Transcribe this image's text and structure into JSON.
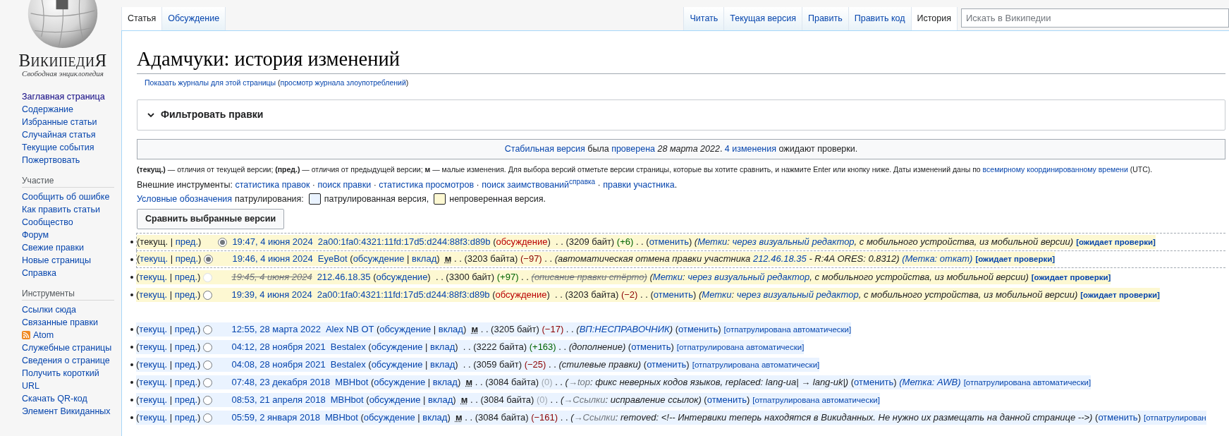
{
  "sidebar": {
    "logo": {
      "wordmark": "ВикипедиЯ",
      "tagline": "Свободная энциклопедия"
    },
    "sections": [
      {
        "items": [
          {
            "label": "Заглавная страница",
            "kind": "link",
            "visited": true
          },
          {
            "label": "Содержание",
            "kind": "link",
            "visited": false
          },
          {
            "label": "Избранные статьи",
            "kind": "link",
            "visited": false
          },
          {
            "label": "Случайная статья",
            "kind": "link",
            "visited": false
          },
          {
            "label": "Текущие события",
            "kind": "link",
            "visited": false
          },
          {
            "label": "Пожертвовать",
            "kind": "link",
            "visited": false
          }
        ]
      },
      {
        "heading": "Участие",
        "items": [
          {
            "label": "Сообщить об ошибке",
            "kind": "link",
            "visited": false
          },
          {
            "label": "Как править статьи",
            "kind": "link",
            "visited": false
          },
          {
            "label": "Сообщество",
            "kind": "link",
            "visited": false
          },
          {
            "label": "Форум",
            "kind": "link",
            "visited": false
          },
          {
            "label": "Свежие правки",
            "kind": "link",
            "visited": false
          },
          {
            "label": "Новые страницы",
            "kind": "link",
            "visited": false
          },
          {
            "label": "Справка",
            "kind": "link",
            "visited": false
          }
        ]
      },
      {
        "heading": "Инструменты",
        "items": [
          {
            "label": "Ссылки сюда",
            "kind": "link",
            "visited": false
          },
          {
            "label": "Связанные правки",
            "kind": "link",
            "visited": false
          },
          {
            "label": "Atom",
            "kind": "feed",
            "visited": false
          },
          {
            "label": "Служебные страницы",
            "kind": "link",
            "visited": false
          },
          {
            "label": "Сведения о странице",
            "kind": "link",
            "visited": false
          },
          {
            "label": "Получить короткий URL",
            "kind": "link",
            "visited": false
          },
          {
            "label": "Скачать QR-код",
            "kind": "link",
            "visited": false
          },
          {
            "label": "Элемент Викиданных",
            "kind": "link",
            "visited": false
          }
        ]
      }
    ]
  },
  "tabs_left": [
    {
      "label": "Статья",
      "selected": true
    },
    {
      "label": "Обсуждение",
      "selected": false
    }
  ],
  "tabs_right": [
    {
      "label": "Читать",
      "selected": false
    },
    {
      "label": "Текущая версия",
      "selected": false
    },
    {
      "label": "Править",
      "selected": false
    },
    {
      "label": "Править код",
      "selected": false
    },
    {
      "label": "История",
      "selected": true
    }
  ],
  "search": {
    "placeholder": "Искать в Википедии"
  },
  "title": "Адамчуки: история изменений",
  "subtitle": [
    {
      "kind": "link",
      "text": "Показать журналы для этой страницы"
    },
    {
      "kind": "text",
      "text": " ("
    },
    {
      "kind": "link",
      "text": "просмотр журнала злоупотреблений"
    },
    {
      "kind": "text",
      "text": ")"
    }
  ],
  "filter": {
    "label": "Фильтровать правки",
    "expanded": false
  },
  "stable_notice": [
    {
      "kind": "link",
      "text": "Стабильная версия"
    },
    {
      "kind": "text",
      "text": " была "
    },
    {
      "kind": "link",
      "text": "проверена"
    },
    {
      "kind": "text",
      "text": " *28 марта 2022*. "
    },
    {
      "kind": "link",
      "text": "4 изменения"
    },
    {
      "kind": "text",
      "text": " ожидают проверки."
    }
  ],
  "note": [
    {
      "kind": "text",
      "text": "**(текущ.)** — отличия от текущей версии; **(пред.)** — отличия от предыдущей версии; **м** — малые изменения. Для выбора версий отметьте версии страницы, которые вы хотите сравнить, и нажмите Enter или кнопку ниже. Даты изменений даны по "
    },
    {
      "kind": "link",
      "text": "всемирному координированному времени"
    },
    {
      "kind": "text",
      "text": " (UTC)."
    }
  ],
  "external_tools": [
    {
      "kind": "text",
      "text": "Внешние инструменты: "
    },
    {
      "kind": "link",
      "text": "статистика правок"
    },
    {
      "kind": "text",
      "text": " · "
    },
    {
      "kind": "link",
      "text": "поиск правки"
    },
    {
      "kind": "text",
      "text": " · "
    },
    {
      "kind": "link",
      "text": "статистика просмотров"
    },
    {
      "kind": "text",
      "text": " · "
    },
    {
      "kind": "link",
      "text": "поиск заимствований"
    },
    {
      "kind": "sup",
      "text": "справка"
    },
    {
      "kind": "text",
      "text": " · "
    },
    {
      "kind": "link",
      "text": "правки участника"
    },
    {
      "kind": "text",
      "text": "."
    }
  ],
  "legend": {
    "link": "Условные обозначения",
    "label": "патрулирования:",
    "items": [
      {
        "label": "патрулированная версия,",
        "color": "#eaf3ff"
      },
      {
        "label": "непроверенная версия.",
        "color": "#fdf8d2"
      }
    ]
  },
  "compare_button": "Сравнить выбранные версии",
  "rows": [
    {
      "pending": true,
      "in_range": true,
      "gap_before": false,
      "radio": {
        "kind": "right",
        "selected": true,
        "disabled": false
      },
      "diff": [
        {
          "kind": "text",
          "text": "(текущ."
        },
        {
          "kind": "text",
          "text": " | "
        },
        {
          "kind": "link",
          "text": "пред."
        },
        {
          "kind": "text",
          "text": ")"
        }
      ],
      "parts": [
        {
          "kind": "date",
          "text": "19:47, 4 июня 2024"
        },
        {
          "kind": "user",
          "text": "2a00:1fa0:4321:11fd:17d5:d244:88f3:d89b"
        },
        {
          "kind": "text",
          "text": " ("
        },
        {
          "kind": "new",
          "text": "обсуждение"
        },
        {
          "kind": "text",
          "text": ")  . . (3209 байт) "
        },
        {
          "kind": "pos",
          "text": "(+6)"
        },
        {
          "kind": "text",
          "text": " . . ("
        },
        {
          "kind": "link",
          "text": "отменить"
        },
        {
          "kind": "text",
          "text": ") "
        },
        {
          "kind": "tag",
          "text": "("
        },
        {
          "kind": "tag_link",
          "text": "Метки"
        },
        {
          "kind": "tag",
          "text": ": "
        },
        {
          "kind": "tag_link",
          "text": "через визуальный редактор"
        },
        {
          "kind": "tag",
          "text": ", с мобильного устройства, из мобильной версии)"
        },
        {
          "kind": "pending",
          "text": "[ожидает проверки]"
        }
      ]
    },
    {
      "pending": true,
      "in_range": true,
      "gap_before": false,
      "radio": {
        "kind": "left",
        "selected": true,
        "disabled": false
      },
      "diff": [
        {
          "kind": "text",
          "text": "("
        },
        {
          "kind": "link",
          "text": "текущ."
        },
        {
          "kind": "text",
          "text": " | "
        },
        {
          "kind": "link",
          "text": "пред."
        },
        {
          "kind": "text",
          "text": ")"
        }
      ],
      "parts": [
        {
          "kind": "date",
          "text": "19:46, 4 июня 2024"
        },
        {
          "kind": "user",
          "text": "EyeBot"
        },
        {
          "kind": "text",
          "text": " ("
        },
        {
          "kind": "link",
          "text": "обсуждение"
        },
        {
          "kind": "text",
          "text": " | "
        },
        {
          "kind": "link",
          "text": "вклад"
        },
        {
          "kind": "text",
          "text": ")  "
        },
        {
          "kind": "minor",
          "text": "м"
        },
        {
          "kind": "text",
          "text": " . . (3203 байта) "
        },
        {
          "kind": "neg",
          "text": "(−97)"
        },
        {
          "kind": "text",
          "text": " . . "
        },
        {
          "kind": "comment",
          "text": "(автоматическая отмена правки участника "
        },
        {
          "kind": "comment_link",
          "text": "212.46.18.35"
        },
        {
          "kind": "comment",
          "text": " - R:4A ORES: 0.8312) "
        },
        {
          "kind": "tag_link",
          "text": "(Метка: откат)"
        },
        {
          "kind": "pending",
          "text": "[ожидает проверки]"
        }
      ]
    },
    {
      "pending": true,
      "in_range": false,
      "gap_before": false,
      "radio": {
        "kind": "left",
        "selected": false,
        "disabled": true
      },
      "diff": [
        {
          "kind": "text",
          "text": "("
        },
        {
          "kind": "link",
          "text": "текущ."
        },
        {
          "kind": "text",
          "text": " | "
        },
        {
          "kind": "link",
          "text": "пред."
        },
        {
          "kind": "text",
          "text": ")"
        }
      ],
      "parts": [
        {
          "kind": "struck_date",
          "text": "19:45, 4 июня 2024"
        },
        {
          "kind": "user",
          "text": "212.46.18.35"
        },
        {
          "kind": "text",
          "text": " ("
        },
        {
          "kind": "link",
          "text": "обсуждение"
        },
        {
          "kind": "text",
          "text": ")  . . (3300 байт) "
        },
        {
          "kind": "pos",
          "text": "(+97)"
        },
        {
          "kind": "text",
          "text": " . . "
        },
        {
          "kind": "struck",
          "text": "(описание правки стёрто)"
        },
        {
          "kind": "tag",
          "text": " ("
        },
        {
          "kind": "tag_link",
          "text": "Метки"
        },
        {
          "kind": "tag",
          "text": ": "
        },
        {
          "kind": "tag_link",
          "text": "через визуальный редактор"
        },
        {
          "kind": "tag",
          "text": ", с мобильного устройства, из мобильной версии)"
        },
        {
          "kind": "pending",
          "text": "[ожидает проверки]"
        }
      ]
    },
    {
      "pending": true,
      "in_range": false,
      "gap_before": false,
      "radio": {
        "kind": "left",
        "selected": false,
        "disabled": false
      },
      "diff": [
        {
          "kind": "text",
          "text": "("
        },
        {
          "kind": "link",
          "text": "текущ."
        },
        {
          "kind": "text",
          "text": " | "
        },
        {
          "kind": "link",
          "text": "пред."
        },
        {
          "kind": "text",
          "text": ")"
        }
      ],
      "parts": [
        {
          "kind": "date",
          "text": "19:39, 4 июня 2024"
        },
        {
          "kind": "user",
          "text": "2a00:1fa0:4321:11fd:17d5:d244:88f3:d89b"
        },
        {
          "kind": "text",
          "text": " ("
        },
        {
          "kind": "new",
          "text": "обсуждение"
        },
        {
          "kind": "text",
          "text": ")  . . (3203 байта) "
        },
        {
          "kind": "neg",
          "text": "(−2)"
        },
        {
          "kind": "text",
          "text": " . . ("
        },
        {
          "kind": "link",
          "text": "отменить"
        },
        {
          "kind": "text",
          "text": ") "
        },
        {
          "kind": "tag",
          "text": "("
        },
        {
          "kind": "tag_link",
          "text": "Метки"
        },
        {
          "kind": "tag",
          "text": ": "
        },
        {
          "kind": "tag_link",
          "text": "через визуальный редактор"
        },
        {
          "kind": "tag",
          "text": ", с мобильного устройства, из мобильной версии)"
        },
        {
          "kind": "pending",
          "text": "[ожидает проверки]"
        }
      ]
    },
    {
      "pending": false,
      "in_range": false,
      "gap_before": true,
      "radio": {
        "kind": "left",
        "selected": false,
        "disabled": false
      },
      "diff": [
        {
          "kind": "text",
          "text": "("
        },
        {
          "kind": "link",
          "text": "текущ."
        },
        {
          "kind": "text",
          "text": " | "
        },
        {
          "kind": "link",
          "text": "пред."
        },
        {
          "kind": "text",
          "text": ")"
        }
      ],
      "parts": [
        {
          "kind": "date",
          "text": "12:55, 28 марта 2022"
        },
        {
          "kind": "user",
          "text": "Alex NB OT"
        },
        {
          "kind": "text",
          "text": " ("
        },
        {
          "kind": "link",
          "text": "обсуждение"
        },
        {
          "kind": "text",
          "text": " | "
        },
        {
          "kind": "link",
          "text": "вклад"
        },
        {
          "kind": "text",
          "text": ")  "
        },
        {
          "kind": "minor",
          "text": "м"
        },
        {
          "kind": "text",
          "text": " . . (3205 байт) "
        },
        {
          "kind": "neg",
          "text": "(−17)"
        },
        {
          "kind": "text",
          "text": " . . "
        },
        {
          "kind": "comment",
          "text": "("
        },
        {
          "kind": "comment_link",
          "text": "ВП:НЕСПРАВОЧНИК"
        },
        {
          "kind": "comment",
          "text": ")"
        },
        {
          "kind": "text",
          "text": " ("
        },
        {
          "kind": "link",
          "text": "отменить"
        },
        {
          "kind": "text",
          "text": ")"
        },
        {
          "kind": "auto",
          "text": "[отпатрулирована автоматически]"
        }
      ]
    },
    {
      "pending": false,
      "in_range": false,
      "gap_before": false,
      "radio": {
        "kind": "left",
        "selected": false,
        "disabled": false
      },
      "diff": [
        {
          "kind": "text",
          "text": "("
        },
        {
          "kind": "link",
          "text": "текущ."
        },
        {
          "kind": "text",
          "text": " | "
        },
        {
          "kind": "link",
          "text": "пред."
        },
        {
          "kind": "text",
          "text": ")"
        }
      ],
      "parts": [
        {
          "kind": "date",
          "text": "04:12, 28 ноября 2021"
        },
        {
          "kind": "user",
          "text": "Bestalex"
        },
        {
          "kind": "text",
          "text": " ("
        },
        {
          "kind": "link",
          "text": "обсуждение"
        },
        {
          "kind": "text",
          "text": " | "
        },
        {
          "kind": "link",
          "text": "вклад"
        },
        {
          "kind": "text",
          "text": ")  . . (3222 байта) "
        },
        {
          "kind": "pos",
          "text": "(+163)"
        },
        {
          "kind": "text",
          "text": " . . "
        },
        {
          "kind": "comment",
          "text": "(дополнение)"
        },
        {
          "kind": "text",
          "text": " ("
        },
        {
          "kind": "link",
          "text": "отменить"
        },
        {
          "kind": "text",
          "text": ")"
        },
        {
          "kind": "auto",
          "text": "[отпатрулирована автоматически]"
        }
      ]
    },
    {
      "pending": false,
      "in_range": false,
      "gap_before": false,
      "radio": {
        "kind": "left",
        "selected": false,
        "disabled": false
      },
      "diff": [
        {
          "kind": "text",
          "text": "("
        },
        {
          "kind": "link",
          "text": "текущ."
        },
        {
          "kind": "text",
          "text": " | "
        },
        {
          "kind": "link",
          "text": "пред."
        },
        {
          "kind": "text",
          "text": ")"
        }
      ],
      "parts": [
        {
          "kind": "date",
          "text": "04:08, 28 ноября 2021"
        },
        {
          "kind": "user",
          "text": "Bestalex"
        },
        {
          "kind": "text",
          "text": " ("
        },
        {
          "kind": "link",
          "text": "обсуждение"
        },
        {
          "kind": "text",
          "text": " | "
        },
        {
          "kind": "link",
          "text": "вклад"
        },
        {
          "kind": "text",
          "text": ")  . . (3059 байт) "
        },
        {
          "kind": "neg",
          "text": "(−25)"
        },
        {
          "kind": "text",
          "text": " . . "
        },
        {
          "kind": "comment",
          "text": "(стилевые правки)"
        },
        {
          "kind": "text",
          "text": " ("
        },
        {
          "kind": "link",
          "text": "отменить"
        },
        {
          "kind": "text",
          "text": ")"
        },
        {
          "kind": "auto",
          "text": "[отпатрулирована автоматически]"
        }
      ]
    },
    {
      "pending": false,
      "in_range": false,
      "gap_before": false,
      "radio": {
        "kind": "left",
        "selected": false,
        "disabled": false
      },
      "diff": [
        {
          "kind": "text",
          "text": "("
        },
        {
          "kind": "link",
          "text": "текущ."
        },
        {
          "kind": "text",
          "text": " | "
        },
        {
          "kind": "link",
          "text": "пред."
        },
        {
          "kind": "text",
          "text": ")"
        }
      ],
      "parts": [
        {
          "kind": "date",
          "text": "07:48, 23 декабря 2018"
        },
        {
          "kind": "user",
          "text": "MBHbot"
        },
        {
          "kind": "text",
          "text": " ("
        },
        {
          "kind": "link",
          "text": "обсуждение"
        },
        {
          "kind": "text",
          "text": " | "
        },
        {
          "kind": "link",
          "text": "вклад"
        },
        {
          "kind": "text",
          "text": ")  "
        },
        {
          "kind": "minor",
          "text": "м"
        },
        {
          "kind": "text",
          "text": " . . (3084 байта) "
        },
        {
          "kind": "zero",
          "text": "(0)"
        },
        {
          "kind": "text",
          "text": " . . "
        },
        {
          "kind": "comment",
          "text": "("
        },
        {
          "kind": "section_link",
          "text": "→top"
        },
        {
          "kind": "comment",
          "text": ": фикс неверных кодов языков, replaced: lang-ua| → lang-uk|)"
        },
        {
          "kind": "text",
          "text": " ("
        },
        {
          "kind": "link",
          "text": "отменить"
        },
        {
          "kind": "text",
          "text": ") "
        },
        {
          "kind": "tag_link",
          "text": "(Метка: AWB)"
        },
        {
          "kind": "auto",
          "text": "[отпатрулирована автоматически]"
        }
      ]
    },
    {
      "pending": false,
      "in_range": false,
      "gap_before": false,
      "radio": {
        "kind": "left",
        "selected": false,
        "disabled": false
      },
      "diff": [
        {
          "kind": "text",
          "text": "("
        },
        {
          "kind": "link",
          "text": "текущ."
        },
        {
          "kind": "text",
          "text": " | "
        },
        {
          "kind": "link",
          "text": "пред."
        },
        {
          "kind": "text",
          "text": ")"
        }
      ],
      "parts": [
        {
          "kind": "date",
          "text": "08:53, 21 апреля 2018"
        },
        {
          "kind": "user",
          "text": "MBHbot"
        },
        {
          "kind": "text",
          "text": " ("
        },
        {
          "kind": "link",
          "text": "обсуждение"
        },
        {
          "kind": "text",
          "text": " | "
        },
        {
          "kind": "link",
          "text": "вклад"
        },
        {
          "kind": "text",
          "text": ")  "
        },
        {
          "kind": "minor",
          "text": "м"
        },
        {
          "kind": "text",
          "text": " . . (3084 байта) "
        },
        {
          "kind": "zero",
          "text": "(0)"
        },
        {
          "kind": "text",
          "text": " . . "
        },
        {
          "kind": "comment",
          "text": "("
        },
        {
          "kind": "section_link",
          "text": "→Ссылки"
        },
        {
          "kind": "comment",
          "text": ": исправление ссылок)"
        },
        {
          "kind": "text",
          "text": " ("
        },
        {
          "kind": "link",
          "text": "отменить"
        },
        {
          "kind": "text",
          "text": ")"
        },
        {
          "kind": "auto",
          "text": "[отпатрулирована автоматически]"
        }
      ]
    },
    {
      "pending": false,
      "in_range": false,
      "gap_before": false,
      "radio": {
        "kind": "left",
        "selected": false,
        "disabled": false
      },
      "diff": [
        {
          "kind": "text",
          "text": "("
        },
        {
          "kind": "link",
          "text": "текущ."
        },
        {
          "kind": "text",
          "text": " | "
        },
        {
          "kind": "link",
          "text": "пред."
        },
        {
          "kind": "text",
          "text": ")"
        }
      ],
      "parts": [
        {
          "kind": "date",
          "text": "05:59, 2 января 2018"
        },
        {
          "kind": "user",
          "text": "MBHbot"
        },
        {
          "kind": "text",
          "text": " ("
        },
        {
          "kind": "link",
          "text": "обсуждение"
        },
        {
          "kind": "text",
          "text": " | "
        },
        {
          "kind": "link",
          "text": "вклад"
        },
        {
          "kind": "text",
          "text": ")  "
        },
        {
          "kind": "minor",
          "text": "м"
        },
        {
          "kind": "text",
          "text": " . . (3084 байта) "
        },
        {
          "kind": "neg",
          "text": "(−161)"
        },
        {
          "kind": "text",
          "text": " . . "
        },
        {
          "kind": "comment",
          "text": "("
        },
        {
          "kind": "section_link",
          "text": "→Ссылки"
        },
        {
          "kind": "comment",
          "text": ": removed: <!-- Интервики теперь находятся в Викиданных. Не нужно их размещать на данной странице -->)"
        },
        {
          "kind": "text",
          "text": " ("
        },
        {
          "kind": "link",
          "text": "отменить"
        },
        {
          "kind": "text",
          "text": ")"
        },
        {
          "kind": "auto",
          "text": "[отпатрулирован"
        }
      ]
    }
  ]
}
